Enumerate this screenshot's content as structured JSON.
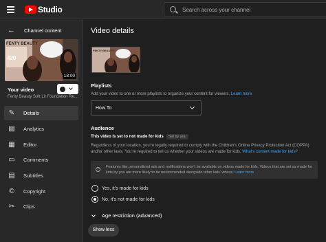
{
  "app": {
    "logo_text": "Studio"
  },
  "search": {
    "placeholder": "Search across your channel"
  },
  "sidebar": {
    "back_label": "Channel content",
    "thumbnail_duration": "18:00",
    "your_video_label": "Your video",
    "video_title": "Fenty Beauty Soft Lit Foundation Re...",
    "items": [
      {
        "label": "Details",
        "icon": "pencil-icon",
        "active": true
      },
      {
        "label": "Analytics",
        "icon": "analytics-icon",
        "active": false
      },
      {
        "label": "Editor",
        "icon": "editor-icon",
        "active": false
      },
      {
        "label": "Comments",
        "icon": "comments-icon",
        "active": false
      },
      {
        "label": "Subtitles",
        "icon": "subtitles-icon",
        "active": false
      },
      {
        "label": "Copyright",
        "icon": "copyright-icon",
        "active": false
      },
      {
        "label": "Clips",
        "icon": "scissors-icon",
        "active": false
      }
    ]
  },
  "main": {
    "title": "Video details",
    "playlists": {
      "title": "Playlists",
      "description": "Add your video to one or more playlists to organize your content for viewers.",
      "learn_more": "Learn more",
      "selected": "How To"
    },
    "audience": {
      "title": "Audience",
      "status": "This video is set to not made for kids",
      "set_by": "Set by you",
      "description": "Regardless of your location, you're legally required to comply with the Children's Online Privacy Protection Act (COPPA) and/or other laws. You're required to tell us whether your videos are made for kids.",
      "desc_link": "What's content made for kids?",
      "info_text": "Features like personalized ads and notifications won't be available on videos made for kids. Videos that are set as made for kids by you are more likely to be recommended alongside other kids' videos.",
      "info_link": "Learn more",
      "option_yes": "Yes, it's made for kids",
      "option_no": "No, it's not made for kids",
      "selected": "no"
    },
    "age_restriction_label": "Age restriction (advanced)",
    "show_less_label": "Show less"
  },
  "colors": {
    "accent_link": "#3ea6ff",
    "brand_red": "#ff0000",
    "background": "#1f1f1f"
  }
}
